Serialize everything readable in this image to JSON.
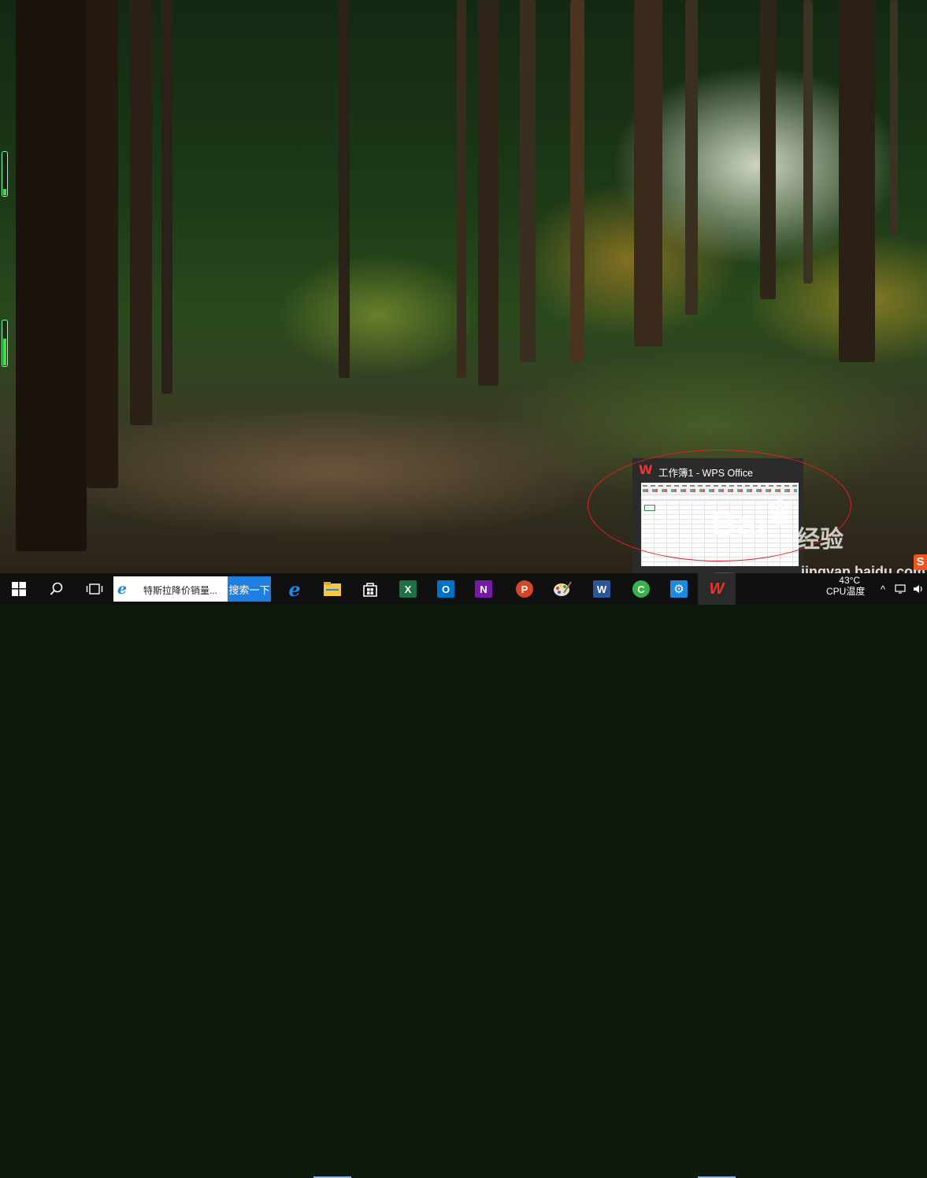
{
  "desktop": {
    "wallpaper": "forest path with sunlight",
    "colors": {
      "foliage": "#1d3a17",
      "sunlight": "#e8c040",
      "path": "#8a6a50"
    }
  },
  "preview": {
    "app_icon": "wps-icon",
    "title": "工作簿1 - WPS Office"
  },
  "taskbar": {
    "start_icon": "windows-logo-icon",
    "search_icon": "search-icon",
    "task_view_icon": "task-view-icon",
    "search_box": {
      "browser_icon": "e",
      "text": "特斯拉降价销量...",
      "button_label": "搜索一下"
    },
    "apps": [
      {
        "name": "edge-icon",
        "glyph": "e",
        "color": "#1e88e5"
      },
      {
        "name": "file-explorer-icon",
        "glyph": "",
        "color": "#f6c744"
      },
      {
        "name": "store-icon",
        "glyph": "",
        "color": "#ffffff"
      },
      {
        "name": "excel-icon",
        "glyph": "X",
        "color": "#1e7145"
      },
      {
        "name": "outlook-icon",
        "glyph": "O",
        "color": "#0072c6"
      },
      {
        "name": "onenote-icon",
        "glyph": "N",
        "color": "#7719aa"
      },
      {
        "name": "powerpoint-icon",
        "glyph": "P",
        "color": "#d24726"
      },
      {
        "name": "paint-icon",
        "glyph": "",
        "color": "#e0e0e0"
      },
      {
        "name": "word-icon",
        "glyph": "W",
        "color": "#2b579a"
      },
      {
        "name": "green-app-icon",
        "glyph": "C",
        "color": "#35b24a"
      },
      {
        "name": "settings-icon",
        "glyph": "⚙",
        "color": "#1e88e5"
      },
      {
        "name": "wps-icon",
        "glyph": "W",
        "color": "#e8352b"
      }
    ],
    "tray": {
      "temperature": "43°C",
      "temperature_label": "CPU温度",
      "chevron": "^",
      "volume_icon": "volume-icon"
    }
  },
  "watermark": {
    "text": "Bai",
    "text2": "经验",
    "url": "jingyan.baidu.com"
  },
  "ime": {
    "label": "S"
  }
}
